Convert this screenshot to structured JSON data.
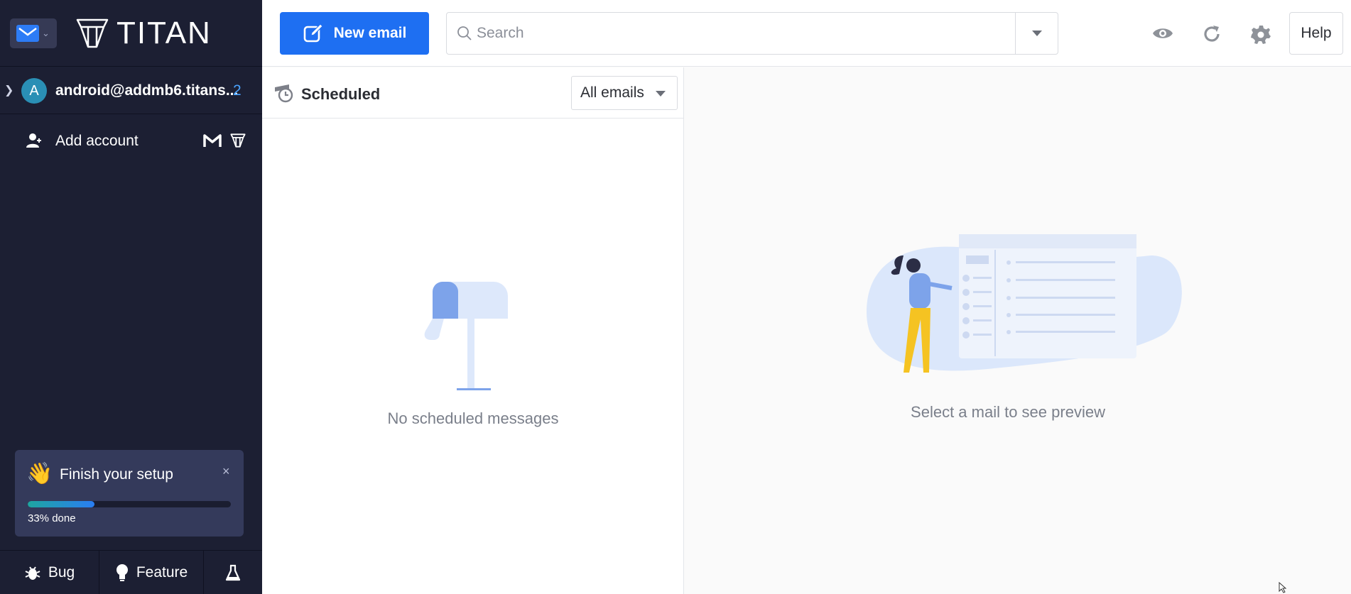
{
  "brand": {
    "name": "TITAN"
  },
  "account": {
    "avatar_letter": "A",
    "email": "android@addmb6.titans...",
    "unread_count": "2"
  },
  "sidebar": {
    "add_account_label": "Add account",
    "setup": {
      "title": "Finish your setup",
      "progress_text": "33% done",
      "progress": 0.33,
      "close": "×"
    },
    "bottom": {
      "bug_label": "Bug",
      "feature_label": "Feature"
    }
  },
  "toolbar": {
    "new_email_label": "New email",
    "search_placeholder": "Search",
    "help_label": "Help"
  },
  "list": {
    "title": "Scheduled",
    "filter_value": "All emails",
    "empty_message": "No scheduled messages"
  },
  "preview": {
    "empty_message": "Select a mail to see preview"
  },
  "colors": {
    "sidebar_bg": "#1c1f33",
    "accent": "#1e6ff2",
    "badge": "#4aa3ff"
  },
  "icons": [
    "mail-icon",
    "titan-logo-icon",
    "add-user-icon",
    "gmail-icon",
    "titan-small-icon",
    "wave-hand-icon",
    "bug-icon",
    "bulb-icon",
    "flask-icon",
    "compose-icon",
    "search-icon",
    "eye-icon",
    "refresh-icon",
    "gear-icon",
    "scheduled-clock-icon"
  ]
}
